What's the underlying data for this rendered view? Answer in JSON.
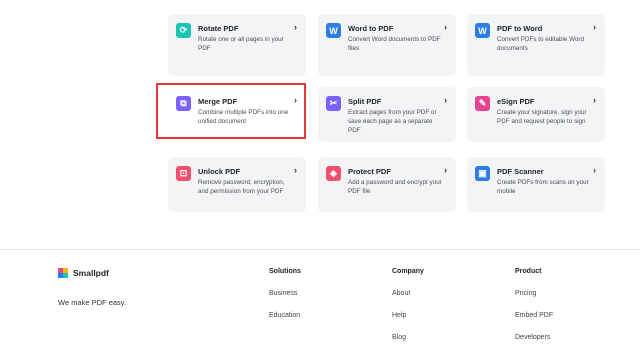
{
  "tools": [
    {
      "title": "Rotate PDF",
      "desc": "Rotate one or all pages in your PDF",
      "icon": "rotate-icon",
      "color": "#1bc4b4",
      "glyph": "⟳"
    },
    {
      "title": "Word to PDF",
      "desc": "Convert Word documents to PDF files",
      "icon": "word-icon",
      "color": "#2b7de9",
      "glyph": "W"
    },
    {
      "title": "PDF to Word",
      "desc": "Convert PDFs to editable Word documents",
      "icon": "word-icon",
      "color": "#2b7de9",
      "glyph": "W"
    },
    {
      "title": "Merge PDF",
      "desc": "Combine multiple PDFs into one unified document",
      "icon": "merge-icon",
      "color": "#7b61ff",
      "glyph": "⧉"
    },
    {
      "title": "Split PDF",
      "desc": "Extract pages from your PDF or save each page as a separate PDF",
      "icon": "scissors-icon",
      "color": "#7b61ff",
      "glyph": "✂"
    },
    {
      "title": "eSign PDF",
      "desc": "Create your signature, sign your PDF and request people to sign",
      "icon": "pen-icon",
      "color": "#e84393",
      "glyph": "✎"
    },
    {
      "title": "Unlock PDF",
      "desc": "Remove password, encryption, and permission from your PDF",
      "icon": "unlock-icon",
      "color": "#f0506e",
      "glyph": "⊡"
    },
    {
      "title": "Protect PDF",
      "desc": "Add a password and encrypt your PDF file",
      "icon": "shield-icon",
      "color": "#f0506e",
      "glyph": "◈"
    },
    {
      "title": "PDF Scanner",
      "desc": "Create PDFs from scans on your mobile",
      "icon": "camera-icon",
      "color": "#2b7de9",
      "glyph": "▣"
    }
  ],
  "chevron_glyph": "›",
  "footer": {
    "brand": "Smallpdf",
    "tagline": "We make PDF easy.",
    "columns": [
      {
        "heading": "Solutions",
        "links": [
          "Business",
          "Education"
        ]
      },
      {
        "heading": "Company",
        "links": [
          "About",
          "Help",
          "Blog"
        ]
      },
      {
        "heading": "Product",
        "links": [
          "Pricing",
          "Embed PDF",
          "Developers"
        ]
      }
    ]
  },
  "colors": {
    "highlight": "#e53935",
    "logo": [
      "#e84393",
      "#f7b500",
      "#2b7de9",
      "#1bc4b4"
    ]
  }
}
